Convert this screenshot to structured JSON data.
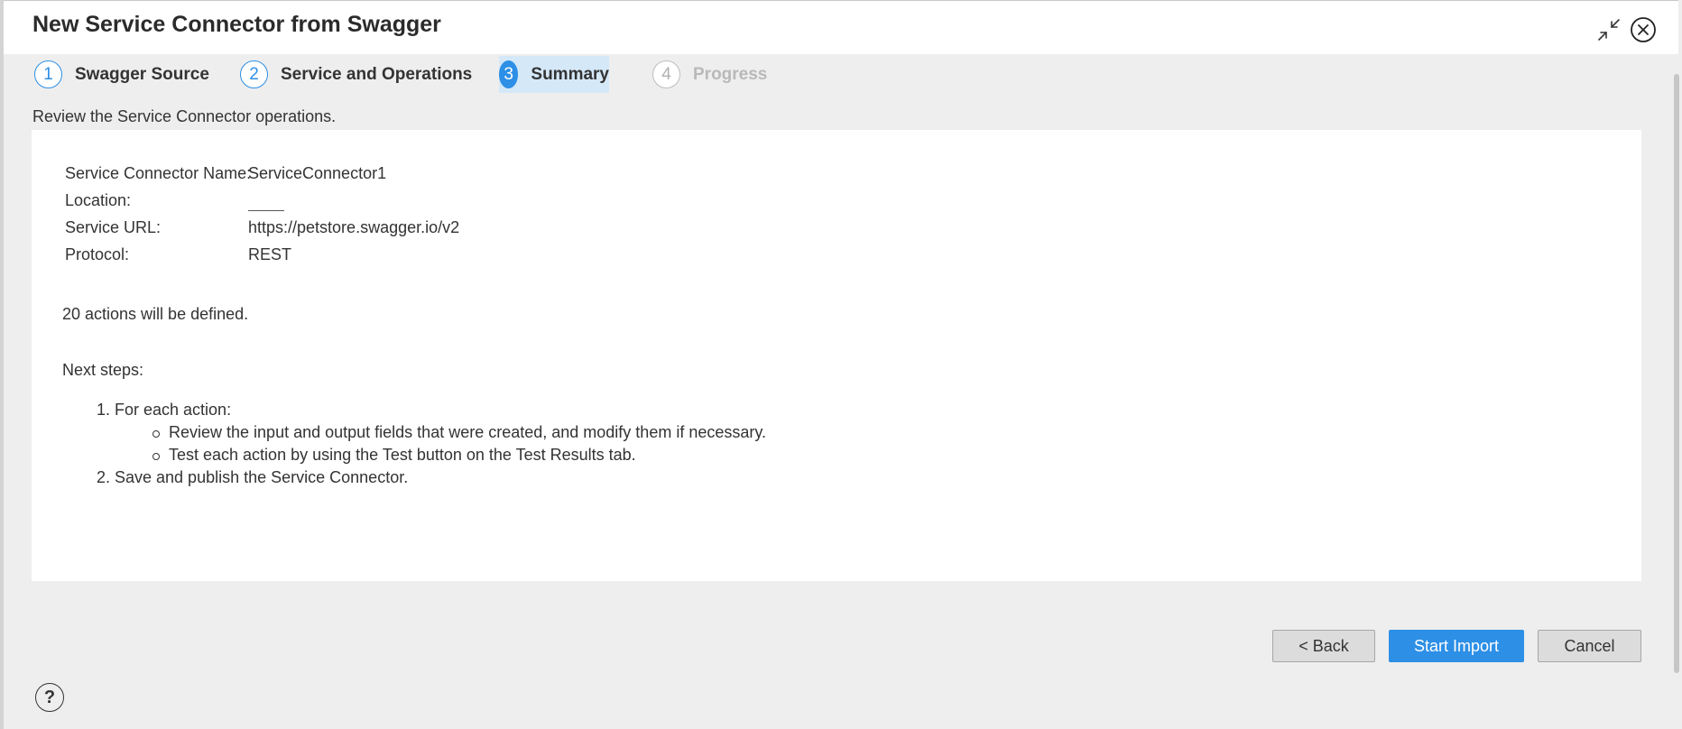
{
  "dialog": {
    "title": "New Service Connector from Swagger",
    "minimize_icon": "collapse-arrows-icon",
    "close_icon": "close-circle-icon"
  },
  "steps": [
    {
      "number": "1",
      "label": "Swagger Source",
      "state": "completed"
    },
    {
      "number": "2",
      "label": "Service and Operations",
      "state": "completed"
    },
    {
      "number": "3",
      "label": "Summary",
      "state": "active"
    },
    {
      "number": "4",
      "label": "Progress",
      "state": "disabled"
    }
  ],
  "instruction": "Review the Service Connector operations.",
  "summary": {
    "name_label": "Service Connector Name:",
    "name_value": "ServiceConnector1",
    "location_label": "Location:",
    "location_value": "",
    "url_label": "Service URL:",
    "url_value": "https://petstore.swagger.io/v2",
    "protocol_label": "Protocol:",
    "protocol_value": "REST",
    "actions_text": "20 actions will be defined.",
    "next_steps_title": "Next steps:",
    "next_steps": [
      {
        "num": "1.",
        "text": "For each action:",
        "sub": [
          "Review the input and output fields that were created, and modify them if necessary.",
          "Test each action by using the Test button on the Test Results tab."
        ]
      },
      {
        "num": "2.",
        "text": "Save and publish the Service Connector."
      }
    ]
  },
  "buttons": {
    "back": "< Back",
    "start": "Start Import",
    "cancel": "Cancel"
  },
  "help": {
    "symbol": "?",
    "icon": "help-icon"
  },
  "colors": {
    "accent": "#2d8fe6",
    "active_step_bg": "#d5e8f8",
    "background": "#eeeeee"
  }
}
